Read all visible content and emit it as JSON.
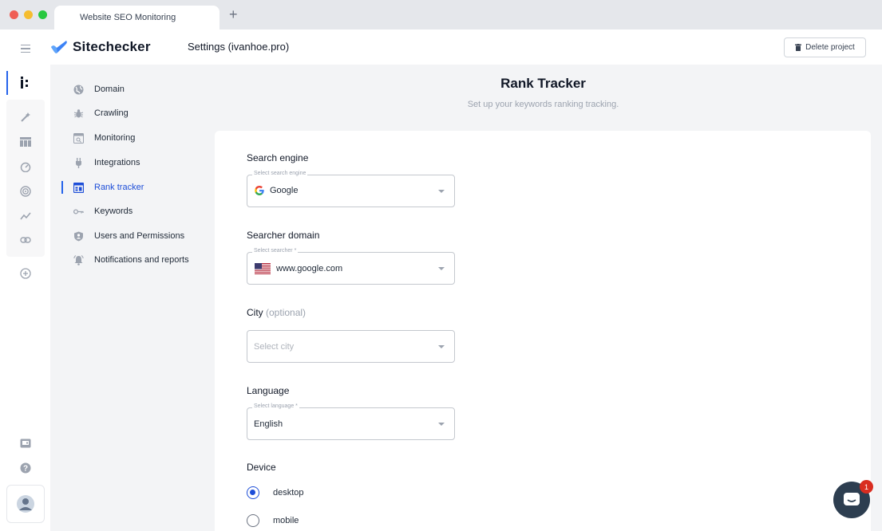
{
  "browser": {
    "tab_title": "Website SEO Monitoring",
    "new_tab_symbol": "+"
  },
  "header": {
    "logo_text": "Sitechecker",
    "page_heading": "Settings (ivanhoe.pro)",
    "delete_label": "Delete project"
  },
  "settings_nav": {
    "items": [
      {
        "label": "Domain",
        "icon": "globe-icon"
      },
      {
        "label": "Crawling",
        "icon": "bug-icon"
      },
      {
        "label": "Monitoring",
        "icon": "monitoring-icon"
      },
      {
        "label": "Integrations",
        "icon": "plug-icon"
      },
      {
        "label": "Rank tracker",
        "icon": "rank-tracker-icon",
        "active": true
      },
      {
        "label": "Keywords",
        "icon": "key-icon"
      },
      {
        "label": "Users and Permissions",
        "icon": "shield-user-icon"
      },
      {
        "label": "Notifications and reports",
        "icon": "bell-icon"
      }
    ]
  },
  "main": {
    "title": "Rank Tracker",
    "subtitle": "Set up your keywords ranking tracking.",
    "search_engine": {
      "label": "Search engine",
      "legend": "Select search engine",
      "value": "Google"
    },
    "searcher_domain": {
      "label": "Searcher domain",
      "legend": "Select searcher *",
      "value": "www.google.com"
    },
    "city": {
      "label": "City",
      "optional": "(optional)",
      "placeholder": "Select city"
    },
    "language": {
      "label": "Language",
      "legend": "Select language *",
      "value": "English"
    },
    "device": {
      "label": "Device",
      "options": [
        {
          "label": "desktop",
          "checked": true
        },
        {
          "label": "mobile",
          "checked": false
        }
      ]
    }
  },
  "chat": {
    "badge_count": "1"
  },
  "colors": {
    "accent": "#1d4ed8",
    "chat_bg": "#2d3e50",
    "badge": "#d92d20"
  }
}
